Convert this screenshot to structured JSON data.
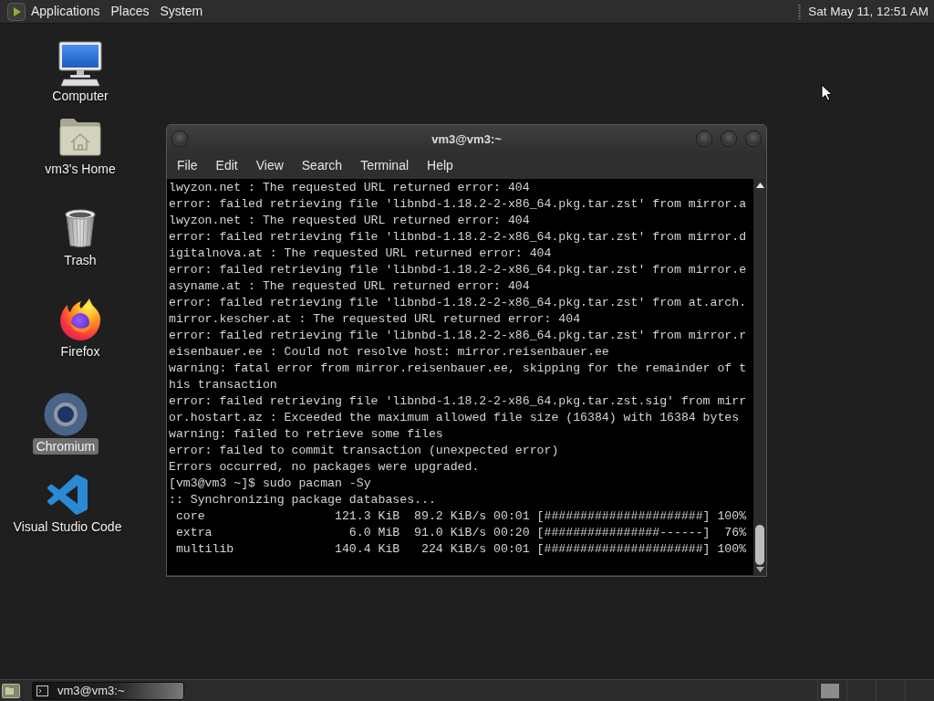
{
  "top_panel": {
    "menus": [
      "Applications",
      "Places",
      "System"
    ],
    "clock": "Sat May 11, 12:51 AM"
  },
  "desktop": {
    "icons": [
      {
        "label": "Computer",
        "kind": "computer",
        "selected": false
      },
      {
        "label": "vm3's Home",
        "kind": "folder",
        "selected": false
      },
      {
        "label": "Trash",
        "kind": "trash",
        "selected": false
      },
      {
        "label": "Firefox",
        "kind": "flame",
        "selected": false
      },
      {
        "label": "Chromium",
        "kind": "ring",
        "selected": true
      },
      {
        "label": "Visual Studio Code",
        "kind": "ribbon",
        "selected": false
      }
    ]
  },
  "terminal_window": {
    "title": "vm3@vm3:~",
    "menu": [
      "File",
      "Edit",
      "View",
      "Search",
      "Terminal",
      "Help"
    ],
    "lines": [
      "lwyzon.net : The requested URL returned error: 404",
      "error: failed retrieving file 'libnbd-1.18.2-2-x86_64.pkg.tar.zst' from mirror.a",
      "lwyzon.net : The requested URL returned error: 404",
      "error: failed retrieving file 'libnbd-1.18.2-2-x86_64.pkg.tar.zst' from mirror.d",
      "igitalnova.at : The requested URL returned error: 404",
      "error: failed retrieving file 'libnbd-1.18.2-2-x86_64.pkg.tar.zst' from mirror.e",
      "asyname.at : The requested URL returned error: 404",
      "error: failed retrieving file 'libnbd-1.18.2-2-x86_64.pkg.tar.zst' from at.arch.",
      "mirror.kescher.at : The requested URL returned error: 404",
      "error: failed retrieving file 'libnbd-1.18.2-2-x86_64.pkg.tar.zst' from mirror.r",
      "eisenbauer.ee : Could not resolve host: mirror.reisenbauer.ee",
      "warning: fatal error from mirror.reisenbauer.ee, skipping for the remainder of t",
      "his transaction",
      "error: failed retrieving file 'libnbd-1.18.2-2-x86_64.pkg.tar.zst.sig' from mirr",
      "or.hostart.az : Exceeded the maximum allowed file size (16384) with 16384 bytes",
      "warning: failed to retrieve some files",
      "error: failed to commit transaction (unexpected error)",
      "Errors occurred, no packages were upgraded.",
      "[vm3@vm3 ~]$ sudo pacman -Sy",
      ":: Synchronizing package databases...",
      " core                  121.3 KiB  89.2 KiB/s 00:01 [######################] 100%",
      " extra                   6.0 MiB  91.0 KiB/s 00:20 [################------]  76%",
      " multilib              140.4 KiB   224 KiB/s 00:01 [######################] 100%"
    ]
  },
  "bottom_panel": {
    "tasks": [
      {
        "label": "vm3@vm3:~",
        "selected": true
      }
    ],
    "workspaces": [
      {
        "selected": true
      },
      {
        "selected": false
      },
      {
        "selected": false
      },
      {
        "selected": false
      }
    ]
  }
}
